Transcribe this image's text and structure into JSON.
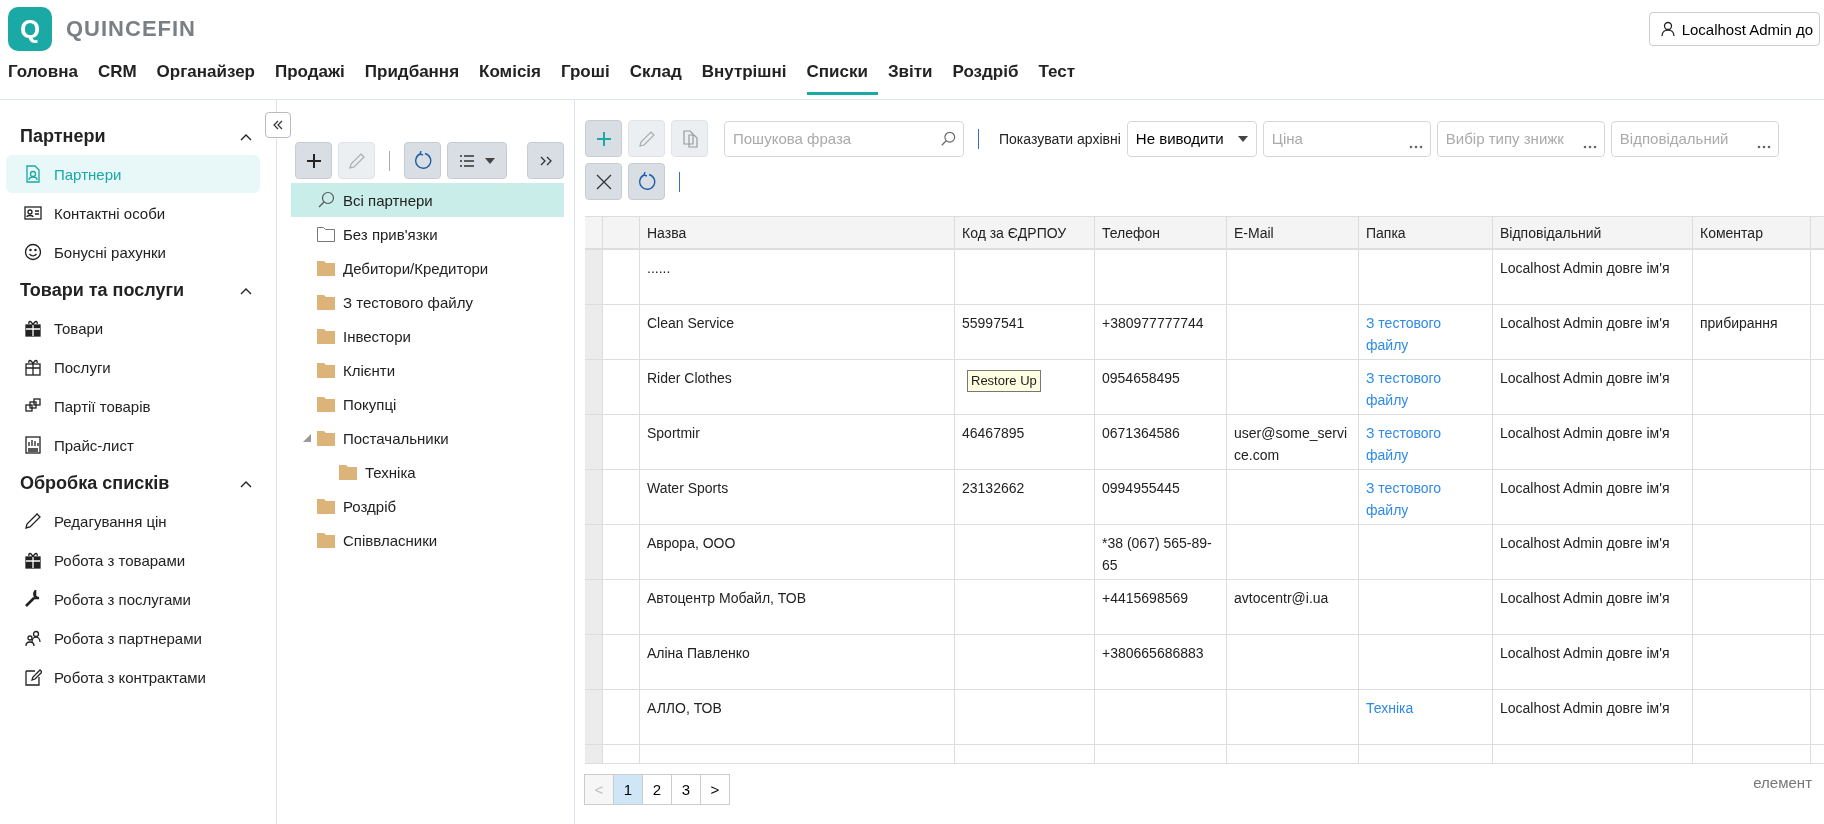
{
  "app": {
    "logo_letter": "Q",
    "brand": "QUINCEFIN",
    "user": "Localhost Admin до"
  },
  "nav": [
    {
      "label": "Головна",
      "selected": false
    },
    {
      "label": "CRM",
      "selected": false
    },
    {
      "label": "Органайзер",
      "selected": false
    },
    {
      "label": "Продажі",
      "selected": false
    },
    {
      "label": "Придбання",
      "selected": false
    },
    {
      "label": "Комісія",
      "selected": false
    },
    {
      "label": "Гроші",
      "selected": false
    },
    {
      "label": "Склад",
      "selected": false
    },
    {
      "label": "Внутрішні",
      "selected": false
    },
    {
      "label": "Списки",
      "selected": true
    },
    {
      "label": "Звіти",
      "selected": false
    },
    {
      "label": "Роздріб",
      "selected": false
    },
    {
      "label": "Тест",
      "selected": false
    }
  ],
  "sidebar": {
    "sections": [
      {
        "title": "Партнери",
        "expanded": true,
        "items": [
          {
            "label": "Партнери",
            "selected": true
          },
          {
            "label": "Контактні особи",
            "selected": false
          },
          {
            "label": "Бонусні рахунки",
            "selected": false
          }
        ]
      },
      {
        "title": "Товари та послуги",
        "expanded": true,
        "items": [
          {
            "label": "Товари",
            "selected": false
          },
          {
            "label": "Послуги",
            "selected": false
          },
          {
            "label": "Партії товарів",
            "selected": false
          },
          {
            "label": "Прайс-лист",
            "selected": false
          }
        ]
      },
      {
        "title": "Обробка списків",
        "expanded": true,
        "items": [
          {
            "label": "Редагування цін",
            "selected": false
          },
          {
            "label": "Робота з товарами",
            "selected": false
          },
          {
            "label": "Робота з послугами",
            "selected": false
          },
          {
            "label": "Робота з партнерами",
            "selected": false
          },
          {
            "label": "Робота з контрактами",
            "selected": false
          }
        ]
      }
    ]
  },
  "tree": [
    {
      "label": "Всі партнери",
      "kind": "search",
      "selected": true
    },
    {
      "label": "Без прив'язки",
      "kind": "empty-folder",
      "selected": false
    },
    {
      "label": "Дебитори/Кредитори",
      "kind": "folder",
      "selected": false
    },
    {
      "label": "З тестового файлу",
      "kind": "folder",
      "selected": false
    },
    {
      "label": "Інвестори",
      "kind": "folder",
      "selected": false
    },
    {
      "label": "Клієнти",
      "kind": "folder",
      "selected": false
    },
    {
      "label": "Покупці",
      "kind": "folder",
      "selected": false
    },
    {
      "label": "Постачальники",
      "kind": "folder",
      "selected": false,
      "expanded": true,
      "children": [
        {
          "label": "Техніка",
          "kind": "folder",
          "selected": false
        }
      ]
    },
    {
      "label": "Роздріб",
      "kind": "folder",
      "selected": false
    },
    {
      "label": "Співвласники",
      "kind": "folder",
      "selected": false
    }
  ],
  "filters": {
    "search_placeholder": "Пошукова фраза",
    "archive_label": "Показувати архівні",
    "archive_value": "Не виводити",
    "price_placeholder": "Ціна",
    "discount_placeholder": "Вибір типу знижк",
    "responsible_placeholder": "Відповідальний"
  },
  "table": {
    "columns": [
      "Назва",
      "Код за ЄДРПОУ",
      "Телефон",
      "E-Mail",
      "Папка",
      "Відповідальний",
      "Коментар"
    ],
    "rows": [
      {
        "name": "......",
        "responsible": "Localhost Admin довге ім'я"
      },
      {
        "name": "Clean Service",
        "code": "55997541",
        "phone": "+380977777744",
        "folder": "З тестового файлу",
        "responsible": "Localhost Admin довге ім'я",
        "comment": "прибирання"
      },
      {
        "name": "Rider Clothes",
        "phone": "0954658495",
        "folder": "З тестового файлу",
        "responsible": "Localhost Admin довге ім'я"
      },
      {
        "name": "Sportmir",
        "code": "46467895",
        "phone": "0671364586",
        "email": "user@some_service.com",
        "folder": "З тестового файлу",
        "responsible": "Localhost Admin довге ім'я"
      },
      {
        "name": "Water Sports",
        "code": "23132662",
        "phone": "0994955445",
        "folder": "З тестового файлу",
        "responsible": "Localhost Admin довге ім'я"
      },
      {
        "name": "Аврора, ООО",
        "phone": "*38 (067) 565-89-65",
        "responsible": "Localhost Admin довге ім'я"
      },
      {
        "name": "Автоцентр Мобайл, ТОВ",
        "phone": "+4415698569",
        "email": "avtocentr@i.ua",
        "responsible": "Localhost Admin довге ім'я"
      },
      {
        "name": "Аліна Павленко",
        "phone": "+380665686883",
        "responsible": "Localhost Admin довге ім'я"
      },
      {
        "name": "АЛЛО, ТОВ",
        "folder": "Техніка",
        "responsible": "Localhost Admin довге ім'я"
      }
    ]
  },
  "tooltip": "Restore Up",
  "pager": {
    "pages": [
      {
        "label": "1",
        "selected": true
      },
      {
        "label": "2",
        "selected": false
      },
      {
        "label": "3",
        "selected": false
      }
    ],
    "next": ">",
    "prev": "<",
    "info": "елемент"
  }
}
